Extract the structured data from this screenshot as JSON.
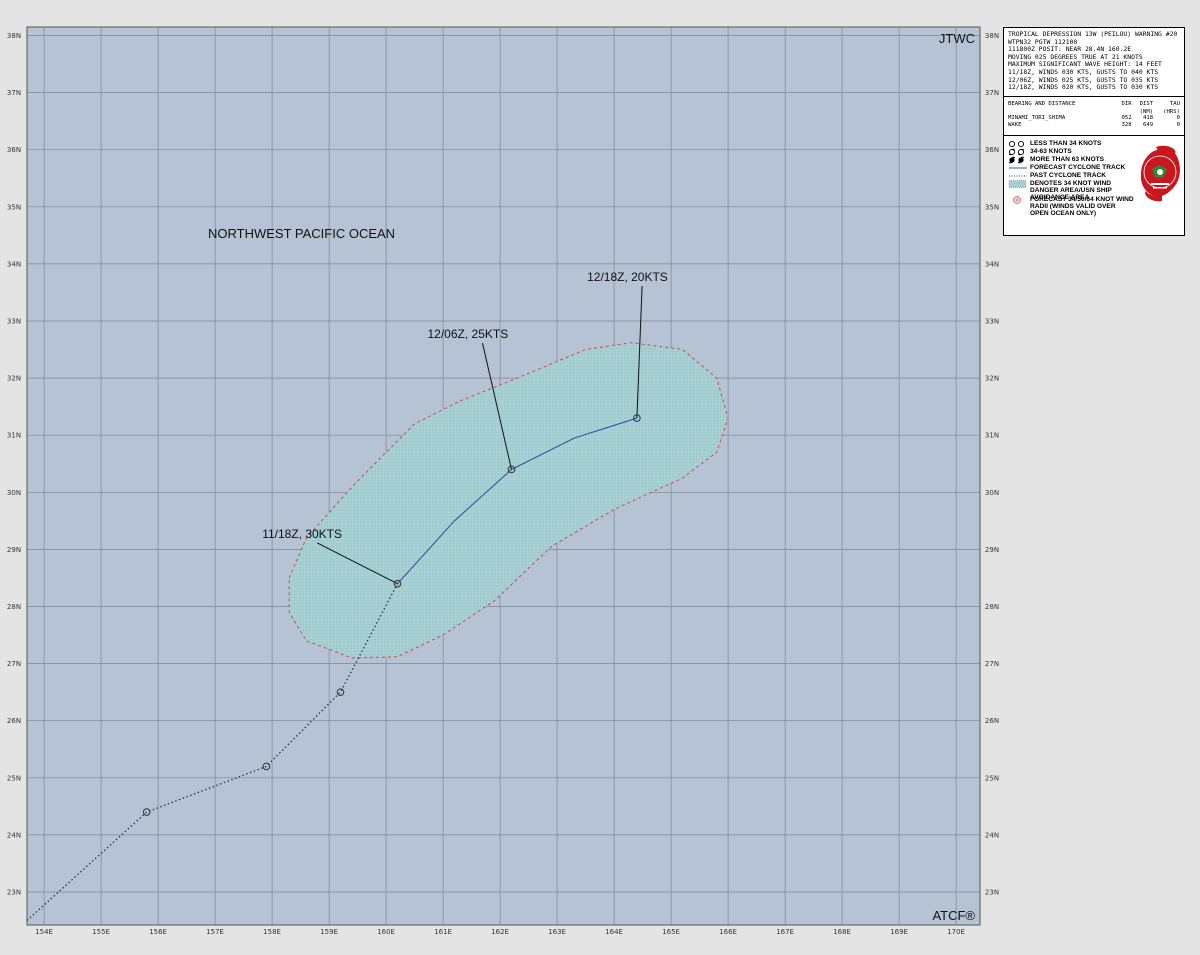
{
  "map": {
    "region_label": "NORTHWEST PACIFIC OCEAN",
    "top_right_label": "JTWC",
    "bottom_right_label": "ATCF®",
    "longitude_labels": [
      "154E",
      "155E",
      "156E",
      "157E",
      "158E",
      "159E",
      "160E",
      "161E",
      "162E",
      "163E",
      "164E",
      "165E",
      "166E",
      "167E",
      "168E",
      "169E",
      "170E"
    ],
    "latitude_labels": [
      "23N",
      "24N",
      "25N",
      "26N",
      "27N",
      "28N",
      "29N",
      "30N",
      "31N",
      "32N",
      "33N",
      "34N",
      "35N",
      "36N",
      "37N",
      "38N"
    ],
    "colors": {
      "ocean": "#b5c3d4",
      "grid": "#7d8593",
      "danger_area": "#a8d2d6",
      "danger_border": "#d04848",
      "forecast_track": "#3355a8",
      "past_track": "#333333",
      "frame_bg": "#e4e4e4"
    }
  },
  "past_track": [
    {
      "lon": 153.7,
      "lat": 22.5
    },
    {
      "lon": 155.8,
      "lat": 24.4
    },
    {
      "lon": 157.9,
      "lat": 25.2
    },
    {
      "lon": 159.2,
      "lat": 26.5
    },
    {
      "lon": 160.2,
      "lat": 28.4
    }
  ],
  "forecast_track": [
    {
      "lon": 160.2,
      "lat": 28.4
    },
    {
      "lon": 161.2,
      "lat": 29.5
    },
    {
      "lon": 162.2,
      "lat": 30.4
    },
    {
      "lon": 163.3,
      "lat": 30.95
    },
    {
      "lon": 164.4,
      "lat": 31.3
    }
  ],
  "track_points": [
    {
      "lon": 155.8,
      "lat": 24.4,
      "kind": "past"
    },
    {
      "lon": 157.9,
      "lat": 25.2,
      "kind": "past"
    },
    {
      "lon": 159.2,
      "lat": 26.5,
      "kind": "past"
    },
    {
      "lon": 160.2,
      "lat": 28.4,
      "kind": "forecast"
    },
    {
      "lon": 162.2,
      "lat": 30.4,
      "kind": "forecast"
    },
    {
      "lon": 164.4,
      "lat": 31.3,
      "kind": "forecast"
    }
  ],
  "forecast_labels": [
    {
      "text": "11/18Z,  30KTS",
      "point_lon": 160.2,
      "point_lat": 28.4,
      "label_lon": 158.3,
      "label_lat": 29.2
    },
    {
      "text": "12/06Z,  25KTS",
      "point_lon": 162.2,
      "point_lat": 30.4,
      "label_lon": 161.2,
      "label_lat": 32.7
    },
    {
      "text": "12/18Z,  20KTS",
      "point_lon": 164.4,
      "point_lat": 31.3,
      "label_lon": 164.0,
      "label_lat": 33.7
    }
  ],
  "danger_area": [
    {
      "lon": 158.3,
      "lat": 28.5
    },
    {
      "lon": 158.6,
      "lat": 29.2
    },
    {
      "lon": 159.5,
      "lat": 30.2
    },
    {
      "lon": 160.5,
      "lat": 31.2
    },
    {
      "lon": 161.3,
      "lat": 31.6
    },
    {
      "lon": 162.3,
      "lat": 32.0
    },
    {
      "lon": 163.5,
      "lat": 32.5
    },
    {
      "lon": 164.3,
      "lat": 32.62
    },
    {
      "lon": 165.2,
      "lat": 32.5
    },
    {
      "lon": 165.8,
      "lat": 32.0
    },
    {
      "lon": 166.0,
      "lat": 31.3
    },
    {
      "lon": 165.8,
      "lat": 30.7
    },
    {
      "lon": 165.2,
      "lat": 30.25
    },
    {
      "lon": 164.0,
      "lat": 29.7
    },
    {
      "lon": 162.9,
      "lat": 29.05
    },
    {
      "lon": 161.9,
      "lat": 28.1
    },
    {
      "lon": 161.0,
      "lat": 27.5
    },
    {
      "lon": 160.2,
      "lat": 27.12
    },
    {
      "lon": 159.4,
      "lat": 27.1
    },
    {
      "lon": 158.6,
      "lat": 27.4
    },
    {
      "lon": 158.3,
      "lat": 27.9
    }
  ],
  "warning": {
    "lines": [
      "TROPICAL DEPRESSION 13W (PEILOU) WARNING #20",
      "WTPN32 PGTW 112100",
      "111800Z POSIT: NEAR 28.4N 160.2E",
      "MOVING 025 DEGREES TRUE AT 21 KNOTS",
      "MAXIMUM SIGNIFICANT WAVE HEIGHT: 14 FEET",
      "11/18Z, WINDS 030 KTS, GUSTS TO 040 KTS",
      "12/06Z, WINDS 025 KTS, GUSTS TO 035 KTS",
      "12/18Z, WINDS 020 KTS, GUSTS TO 030 KTS"
    ],
    "bearing_title": "BEARING AND DISTANCE",
    "bearing_headers": [
      "DIR",
      "DIST",
      "TAU"
    ],
    "bearing_subheaders": [
      "(NM)",
      "(HRS)"
    ],
    "bearing_rows": [
      {
        "place": "MINAMI_TORI_SHIMA",
        "dir": "052",
        "dist": "418",
        "tau": "0"
      },
      {
        "place": "WAKE",
        "dir": "328",
        "dist": "649",
        "tau": "0"
      }
    ]
  },
  "legend": {
    "items": [
      "LESS THAN 34 KNOTS",
      "34-63 KNOTS",
      "MORE THAN 63 KNOTS",
      "FORECAST CYCLONE TRACK",
      "PAST CYCLONE TRACK",
      "DENOTES 34 KNOT WIND DANGER AREA/USN SHIP AVOIDANCE AREA",
      "FORECAST 34/50/64 KNOT WIND RADII (WINDS VALID OVER OPEN OCEAN ONLY)"
    ],
    "logo_icon": "hurricane-emblem-icon"
  }
}
